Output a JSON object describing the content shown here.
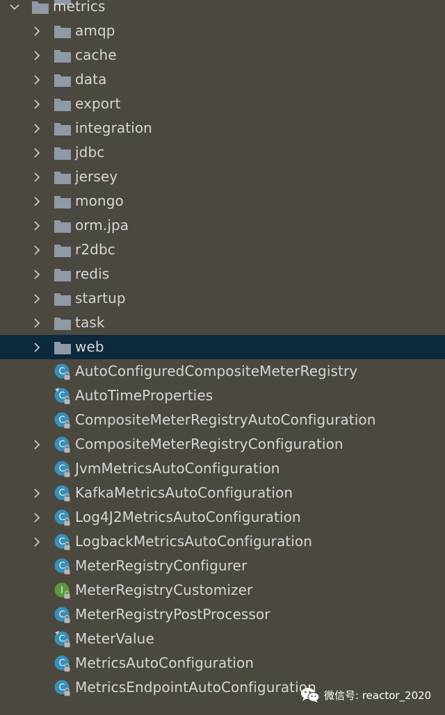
{
  "colors": {
    "background": "#4b483f",
    "selection": "#0d293e",
    "text": "#d6d6d6",
    "folder": "#8e9aa5",
    "class_icon": "#3a8fb7",
    "interface_icon": "#5a9a3a",
    "lock": "#b8b8b8"
  },
  "tree": {
    "items": [
      {
        "label": "metrics",
        "type": "folder",
        "expanded": true,
        "level": 0,
        "has_children": true
      },
      {
        "label": "amqp",
        "type": "folder",
        "expanded": false,
        "level": 1,
        "has_children": true
      },
      {
        "label": "cache",
        "type": "folder",
        "expanded": false,
        "level": 1,
        "has_children": true
      },
      {
        "label": "data",
        "type": "folder",
        "expanded": false,
        "level": 1,
        "has_children": true
      },
      {
        "label": "export",
        "type": "folder",
        "expanded": false,
        "level": 1,
        "has_children": true
      },
      {
        "label": "integration",
        "type": "folder",
        "expanded": false,
        "level": 1,
        "has_children": true
      },
      {
        "label": "jdbc",
        "type": "folder",
        "expanded": false,
        "level": 1,
        "has_children": true
      },
      {
        "label": "jersey",
        "type": "folder",
        "expanded": false,
        "level": 1,
        "has_children": true
      },
      {
        "label": "mongo",
        "type": "folder",
        "expanded": false,
        "level": 1,
        "has_children": true
      },
      {
        "label": "orm.jpa",
        "type": "folder",
        "expanded": false,
        "level": 1,
        "has_children": true
      },
      {
        "label": "r2dbc",
        "type": "folder",
        "expanded": false,
        "level": 1,
        "has_children": true
      },
      {
        "label": "redis",
        "type": "folder",
        "expanded": false,
        "level": 1,
        "has_children": true
      },
      {
        "label": "startup",
        "type": "folder",
        "expanded": false,
        "level": 1,
        "has_children": true
      },
      {
        "label": "task",
        "type": "folder",
        "expanded": false,
        "level": 1,
        "has_children": true
      },
      {
        "label": "web",
        "type": "folder",
        "expanded": false,
        "level": 1,
        "has_children": true,
        "selected": true
      },
      {
        "label": "AutoConfiguredCompositeMeterRegistry",
        "type": "class",
        "level": 1,
        "has_children": false
      },
      {
        "label": "AutoTimeProperties",
        "type": "class-props",
        "level": 1,
        "has_children": false
      },
      {
        "label": "CompositeMeterRegistryAutoConfiguration",
        "type": "class",
        "level": 1,
        "has_children": false
      },
      {
        "label": "CompositeMeterRegistryConfiguration",
        "type": "class",
        "level": 1,
        "has_children": true
      },
      {
        "label": "JvmMetricsAutoConfiguration",
        "type": "class",
        "level": 1,
        "has_children": false
      },
      {
        "label": "KafkaMetricsAutoConfiguration",
        "type": "class",
        "level": 1,
        "has_children": true
      },
      {
        "label": "Log4J2MetricsAutoConfiguration",
        "type": "class",
        "level": 1,
        "has_children": true
      },
      {
        "label": "LogbackMetricsAutoConfiguration",
        "type": "class",
        "level": 1,
        "has_children": true
      },
      {
        "label": "MeterRegistryConfigurer",
        "type": "class",
        "level": 1,
        "has_children": false
      },
      {
        "label": "MeterRegistryCustomizer",
        "type": "interface",
        "level": 1,
        "has_children": false
      },
      {
        "label": "MeterRegistryPostProcessor",
        "type": "class",
        "level": 1,
        "has_children": false
      },
      {
        "label": "MeterValue",
        "type": "class-props",
        "level": 1,
        "has_children": false
      },
      {
        "label": "MetricsAutoConfiguration",
        "type": "class",
        "level": 1,
        "has_children": false
      },
      {
        "label": "MetricsEndpointAutoConfiguration",
        "type": "class",
        "level": 1,
        "has_children": false
      }
    ]
  },
  "watermark": {
    "text": "微信号: reactor_2020",
    "icon": "wechat-icon"
  }
}
